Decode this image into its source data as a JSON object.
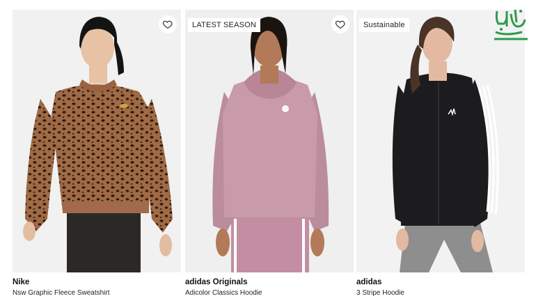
{
  "products": [
    {
      "brand": "Nike",
      "name": "Nsw Graphic Fleece Sweatshirt",
      "tag": "",
      "favorite_icon": "heart-outline-icon",
      "colors": {
        "garment": "#8a5a3c",
        "pants": "#2b2825",
        "skin": "#e7c2a4",
        "hair": "#141414"
      }
    },
    {
      "brand": "adidas Originals",
      "name": "Adicolor Classics Hoodie",
      "tag": "LATEST SEASON",
      "favorite_icon": "heart-outline-icon",
      "colors": {
        "garment": "#c99aaa",
        "pants": "#c38ea1",
        "skin": "#b27a58",
        "hair": "#1a1411"
      }
    },
    {
      "brand": "adidas",
      "name": "3 Stripe Hoodie",
      "tag": "Sustainable",
      "favorite_icon": "",
      "colors": {
        "garment": "#1c1c1e",
        "pants": "#8e8e8e",
        "skin": "#e3b9a1",
        "hair": "#4a3327"
      }
    }
  ],
  "logo": {
    "icon": "saudi-logo-icon",
    "color": "#2e9a4a"
  }
}
